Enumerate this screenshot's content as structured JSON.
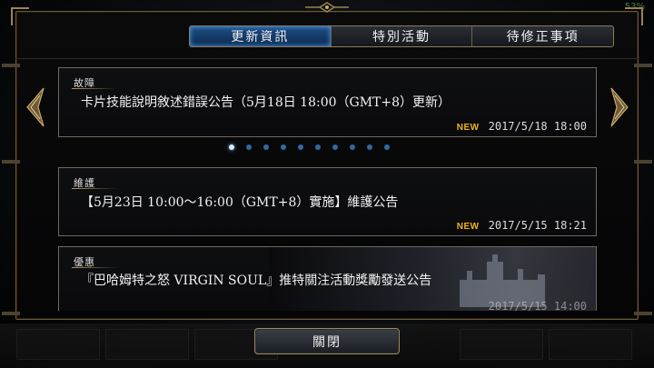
{
  "status": {
    "battery": "53%"
  },
  "tabs": [
    {
      "label": "更新資訊",
      "active": true
    },
    {
      "label": "特別活動",
      "active": false
    },
    {
      "label": "待修正事項",
      "active": false
    }
  ],
  "news": [
    {
      "category": "故障",
      "title": "卡片技能說明敘述錯誤公告（5月18日 18:00（GMT+8）更新）",
      "badge": "NEW",
      "date": "2017/5/18 18:00"
    },
    {
      "category": "維護",
      "title": "【5月23日 10:00～16:00（GMT+8）實施】維護公告",
      "badge": "NEW",
      "date": "2017/5/15 18:21"
    },
    {
      "category": "優惠",
      "title": "『巴哈姆特之怒 VIRGIN SOUL』推特關注活動獎勵發送公告",
      "date": "2017/5/15 14:00"
    }
  ],
  "pager": {
    "count": 10,
    "current": 1
  },
  "close_label": "關閉",
  "colors": {
    "accent_tab": "#1d4d82",
    "new_badge": "#f0b417",
    "frame_gold": "#9a8452"
  }
}
